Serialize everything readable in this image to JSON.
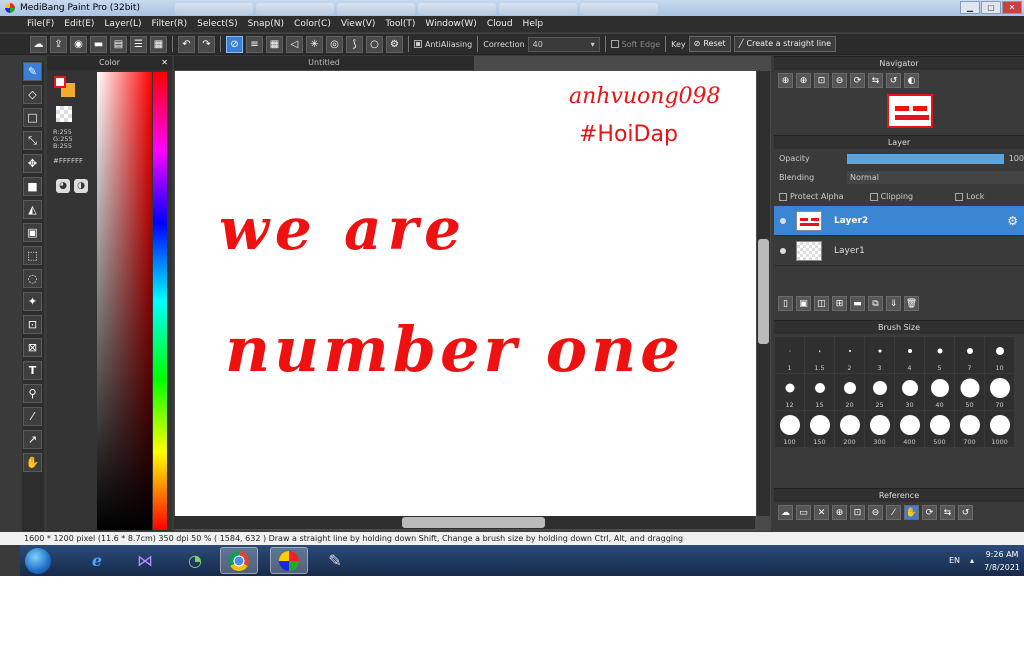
{
  "window": {
    "title": "MediBang Paint Pro (32bit)",
    "min": "▁",
    "max": "▢",
    "close": "✕"
  },
  "menu": [
    "File(F)",
    "Edit(E)",
    "Layer(L)",
    "Filter(R)",
    "Select(S)",
    "Snap(N)",
    "Color(C)",
    "View(V)",
    "Tool(T)",
    "Window(W)",
    "Cloud",
    "Help"
  ],
  "toolbar": {
    "antialiasing": "AntiAliasing",
    "correction_label": "Correction",
    "correction_value": "40",
    "soft_edge": "Soft Edge",
    "key": "Key",
    "reset": "Reset",
    "straight_line": "Create a straight line"
  },
  "color_panel": {
    "title": "Color",
    "r": "R:255",
    "g": "G:255",
    "b": "B:255",
    "hex": "#FFFFFF",
    "fg": "#ffffff",
    "bg": "#f4a92f"
  },
  "canvas": {
    "tab": "Untitled",
    "signature": "anhvuong098",
    "hashtag": "#HoiDap",
    "line1": "we are",
    "line2": "number one"
  },
  "navigator": {
    "title": "Navigator"
  },
  "layer_panel": {
    "title": "Layer",
    "opacity_label": "Opacity",
    "opacity_value": "100",
    "blending_label": "Blending",
    "blending_value": "Normal",
    "protect_alpha": "Protect Alpha",
    "clipping": "Clipping",
    "lock": "Lock",
    "layers": [
      "Layer2",
      "Layer1"
    ]
  },
  "brush_size": {
    "title": "Brush Size",
    "sizes": [
      "1",
      "1.5",
      "2",
      "3",
      "4",
      "5",
      "7",
      "10",
      "12",
      "15",
      "20",
      "25",
      "30",
      "40",
      "50",
      "70",
      "100",
      "150",
      "200",
      "300",
      "400",
      "500",
      "700",
      "1000"
    ]
  },
  "reference": {
    "title": "Reference"
  },
  "status": "1600 * 1200 pixel  (11.6 * 8.7cm)  350 dpi  50 %  ( 1584, 632 )  Draw a straight line by holding down Shift, Change a brush size by holding down Ctrl, Alt, and dragging",
  "taskbar": {
    "lang": "EN",
    "time": "9:26 AM",
    "date": "7/8/2021"
  }
}
